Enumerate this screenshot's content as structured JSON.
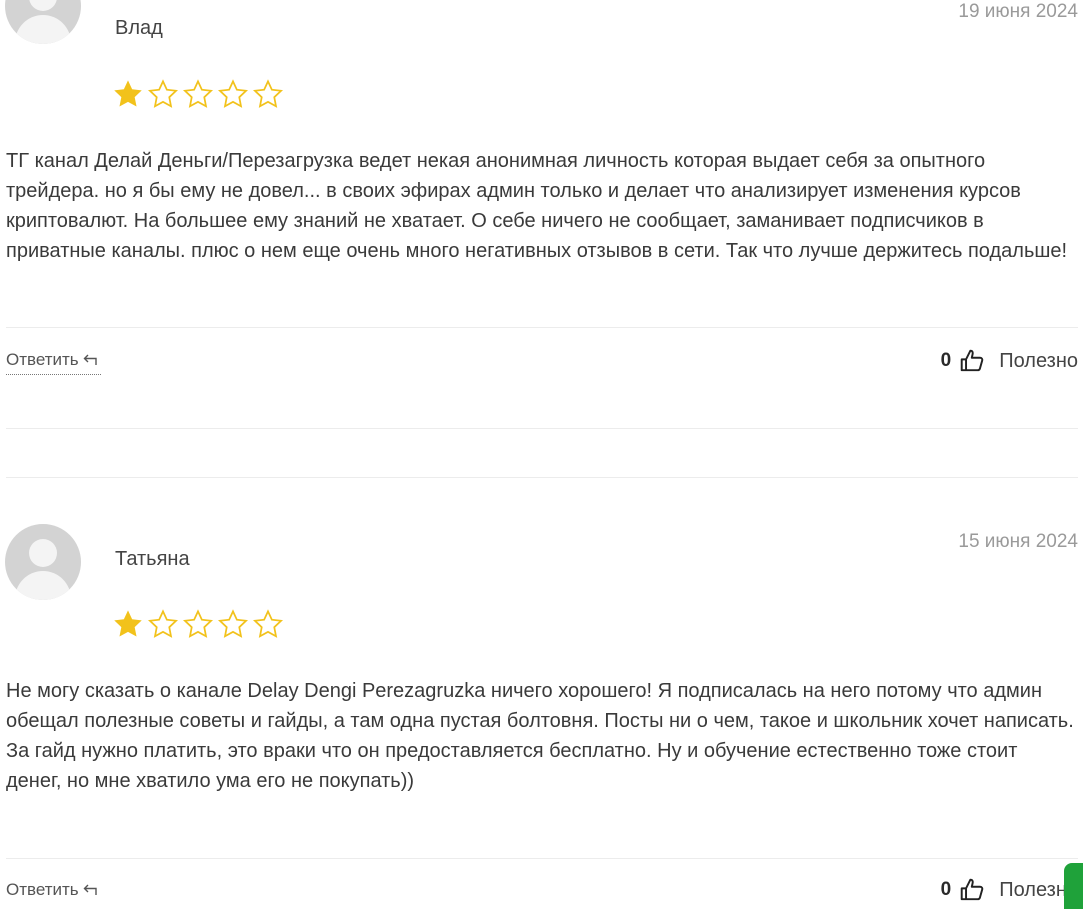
{
  "colors": {
    "star": "#f2c21b",
    "accent_button": "#1fa23a"
  },
  "reviews": [
    {
      "author": "Влад",
      "date": "19 июня 2024",
      "rating": 1,
      "rating_max": 5,
      "text": "ТГ канал Делай Деньги/Перезагрузка ведет некая анонимная личность которая выдает себя за опытного трейдера. но я бы ему не довел... в своих эфирах админ только и делает что анализирует изменения курсов криптовалют. На большее ему знаний не хватает. О себе ничего не сообщает, заманивает подписчиков в приватные каналы. плюс о нем еще очень много негативных отзывов в сети. Так что лучше держитесь подальше!",
      "reply_label": "Ответить",
      "useful_count": "0",
      "useful_label": "Полезно"
    },
    {
      "author": "Татьяна",
      "date": "15 июня 2024",
      "rating": 1,
      "rating_max": 5,
      "text": "Не могу сказать о канале Delay Dengi Perezagruzka ничего хорошего! Я подписалась на него потому что админ обещал полезные советы и гайды, а там одна пустая болтовня. Посты ни о чем, такое и школьник хочет написать. За гайд нужно платить, это враки что он предоставляется бесплатно. Ну и обучение естественно тоже стоит денег, но мне хватило ума его не покупать))",
      "reply_label": "Ответить",
      "useful_count": "0",
      "useful_label": "Полезно"
    }
  ]
}
